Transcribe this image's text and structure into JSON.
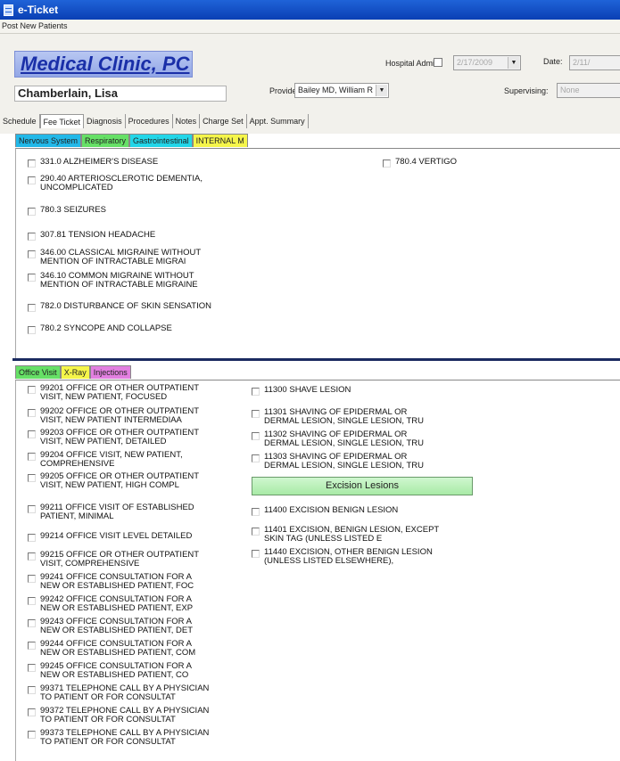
{
  "window": {
    "title": "e-Ticket"
  },
  "menu": {
    "item": "Post New Patients"
  },
  "header": {
    "clinic_name": "Medical Clinic, PC",
    "patient_name": "Chamberlain, Lisa",
    "hospital_admit_label": "Hospital Admit",
    "hospital_admit_date": "2/17/2009",
    "date_label": "Date:",
    "date_value": "2/11/",
    "provider_label": "Provider:",
    "provider_value": "Bailey MD, William R",
    "supervising_label": "Supervising:",
    "supervising_value": "None"
  },
  "tabs": [
    "Schedule",
    "Fee Ticket",
    "Diagnosis",
    "Procedures",
    "Notes",
    "Charge Set",
    "Appt. Summary"
  ],
  "active_tab": "Fee Ticket",
  "diagnosis_tabs": [
    {
      "label": "Nervous System",
      "color": "#22b8e8"
    },
    {
      "label": "Respiratory",
      "color": "#66e066"
    },
    {
      "label": "Gastrointestinal",
      "color": "#22d6e8"
    },
    {
      "label": "INTERNAL M",
      "color": "#f5f54a"
    }
  ],
  "diagnosis_items": [
    {
      "lines": [
        "331.0 ALZHEIMER'S DISEASE"
      ]
    },
    {
      "lines": [
        "290.40 ARTERIOSCLEROTIC DEMENTIA,",
        "UNCOMPLICATED"
      ]
    },
    {
      "lines": [
        "780.3 SEIZURES"
      ]
    },
    {
      "lines": [
        "307.81 TENSION HEADACHE"
      ]
    },
    {
      "lines": [
        "346.00 CLASSICAL MIGRAINE WITHOUT",
        "MENTION OF INTRACTABLE MIGRAI"
      ]
    },
    {
      "lines": [
        "346.10 COMMON MIGRAINE WITHOUT",
        "MENTION OF INTRACTABLE MIGRAINE"
      ]
    },
    {
      "lines": [
        "782.0 DISTURBANCE OF SKIN SENSATION"
      ]
    },
    {
      "lines": [
        "780.2 SYNCOPE AND COLLAPSE"
      ]
    },
    {
      "lines": [
        "780.4 VERTIGO"
      ]
    }
  ],
  "procedure_tabs": [
    {
      "label": "Office Visit",
      "color": "#66e066"
    },
    {
      "label": "X-Ray",
      "color": "#f5f54a"
    },
    {
      "label": "Injections",
      "color": "#e27fe0"
    }
  ],
  "procedure_items_left": [
    {
      "lines": [
        "99201 OFFICE OR OTHER OUTPATIENT",
        "VISIT, NEW PATIENT, FOCUSED"
      ]
    },
    {
      "lines": [
        "99202 OFFICE OR OTHER OUTPATIENT",
        "VISIT, NEW PATIENT INTERMEDIAA"
      ]
    },
    {
      "lines": [
        "99203 OFFICE OR OTHER OUTPATIENT",
        "VISIT, NEW PATIENT, DETAILED"
      ]
    },
    {
      "lines": [
        "99204 OFFICE VISIT, NEW PATIENT,",
        "COMPREHENSIVE"
      ]
    },
    {
      "lines": [
        "99205 OFFICE OR OTHER OUTPATIENT",
        "VISIT, NEW PATIENT, HIGH COMPL"
      ]
    },
    {
      "lines": [
        "99211 OFFICE VISIT OF ESTABLISHED",
        "PATIENT, MINIMAL"
      ]
    },
    {
      "lines": [
        "99214 OFFICE VISIT LEVEL DETAILED"
      ]
    },
    {
      "lines": [
        "99215 OFFICE OR OTHER OUTPATIENT",
        "VISIT, COMPREHENSIVE"
      ]
    },
    {
      "lines": [
        "99241 OFFICE CONSULTATION FOR A",
        "NEW OR ESTABLISHED PATIENT, FOC"
      ]
    },
    {
      "lines": [
        "99242 OFFICE CONSULTATION FOR A",
        "NEW OR ESTABLISHED PATIENT, EXP"
      ]
    },
    {
      "lines": [
        "99243 OFFICE CONSULTATION FOR A",
        "NEW OR ESTABLISHED PATIENT, DET"
      ]
    },
    {
      "lines": [
        "99244 OFFICE CONSULTATION FOR A",
        "NEW OR ESTABLISHED PATIENT, COM"
      ]
    },
    {
      "lines": [
        "99245 OFFICE CONSULTATION FOR A",
        "NEW OR ESTABLISHED PATIENT,  CO"
      ]
    },
    {
      "lines": [
        "99371 TELEPHONE CALL BY A PHYSICIAN",
        "TO PATIENT OR FOR CONSULTAT"
      ]
    },
    {
      "lines": [
        "99372 TELEPHONE CALL BY A PHYSICIAN",
        "TO PATIENT OR FOR CONSULTAT"
      ]
    },
    {
      "lines": [
        "99373 TELEPHONE CALL BY A PHYSICIAN",
        "TO PATIENT OR FOR CONSULTAT"
      ]
    }
  ],
  "procedure_items_right": [
    {
      "lines": [
        "11300 SHAVE LESION"
      ]
    },
    {
      "lines": [
        "11301 SHAVING OF EPIDERMAL OR",
        "DERMAL LESION, SINGLE LESION, TRU"
      ]
    },
    {
      "lines": [
        "11302 SHAVING OF EPIDERMAL OR",
        "DERMAL LESION, SINGLE LESION, TRU"
      ]
    },
    {
      "lines": [
        "11303 SHAVING OF EPIDERMAL OR",
        "DERMAL LESION, SINGLE LESION, TRU"
      ]
    },
    {
      "lines": [
        "11400 EXCISION BENIGN LESION"
      ]
    },
    {
      "lines": [
        "11401 EXCISION, BENIGN LESION, EXCEPT",
        "SKIN TAG (UNLESS LISTED E"
      ]
    },
    {
      "lines": [
        "11440 EXCISION, OTHER BENIGN LESION",
        "(UNLESS LISTED ELSEWHERE),"
      ]
    }
  ],
  "excision_button": "Excision Lesions"
}
